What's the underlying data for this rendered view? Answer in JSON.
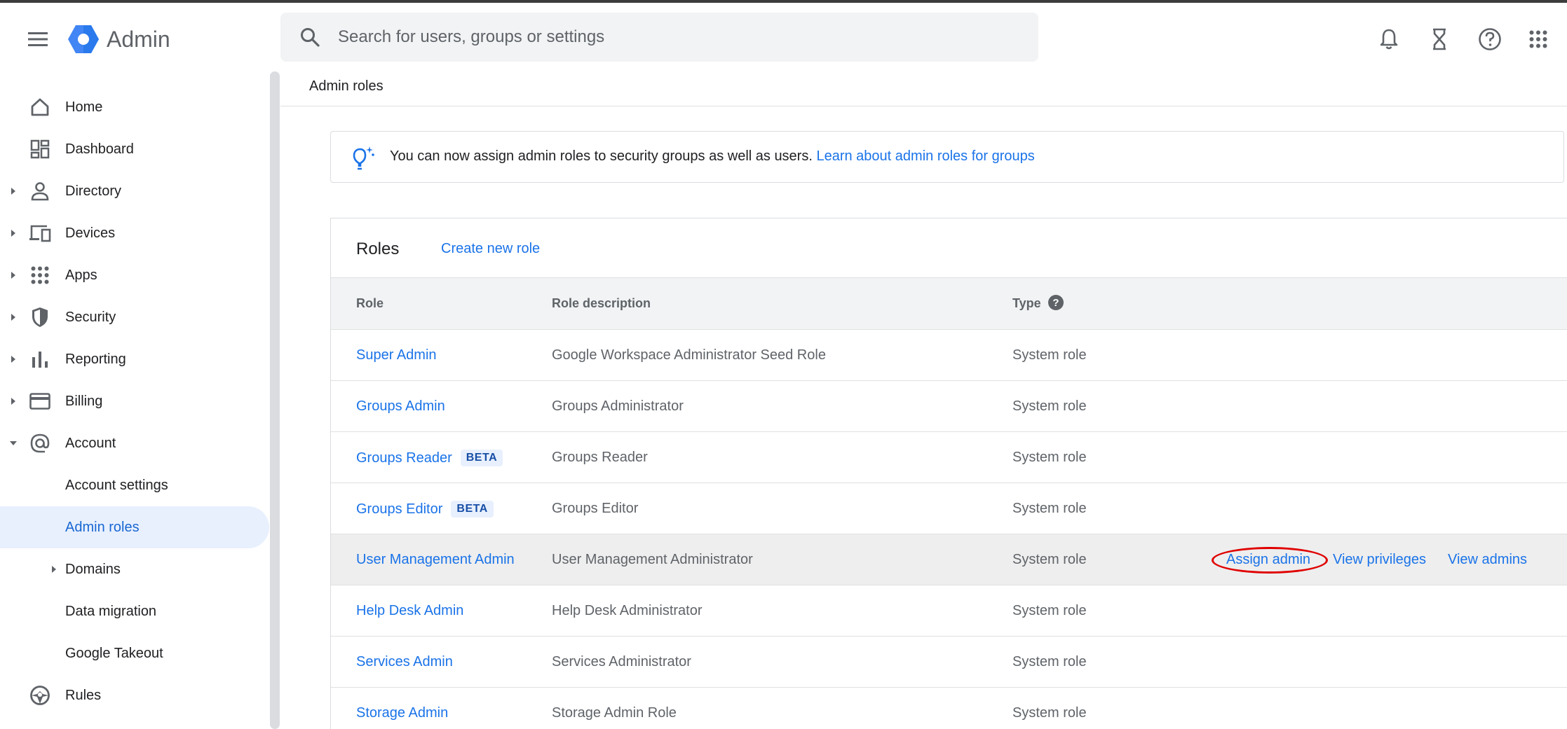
{
  "app": {
    "title": "Admin"
  },
  "search": {
    "placeholder": "Search for users, groups or settings"
  },
  "header_icons": [
    "notifications-icon",
    "tasks-hourglass-icon",
    "help-icon",
    "apps-grid-icon"
  ],
  "sidebar": {
    "items": [
      {
        "label": "Home",
        "icon": "home-icon",
        "expandable": false
      },
      {
        "label": "Dashboard",
        "icon": "dashboard-icon",
        "expandable": false
      },
      {
        "label": "Directory",
        "icon": "person-icon",
        "expandable": true
      },
      {
        "label": "Devices",
        "icon": "devices-icon",
        "expandable": true
      },
      {
        "label": "Apps",
        "icon": "apps-icon",
        "expandable": true
      },
      {
        "label": "Security",
        "icon": "shield-icon",
        "expandable": true
      },
      {
        "label": "Reporting",
        "icon": "bar-chart-icon",
        "expandable": true
      },
      {
        "label": "Billing",
        "icon": "credit-card-icon",
        "expandable": true
      },
      {
        "label": "Account",
        "icon": "at-sign-icon",
        "expandable": true,
        "expanded": true
      },
      {
        "label": "Account settings",
        "sub": true
      },
      {
        "label": "Admin roles",
        "sub": true,
        "active": true
      },
      {
        "label": "Domains",
        "sub": true,
        "expandable": true
      },
      {
        "label": "Data migration",
        "sub": true
      },
      {
        "label": "Google Takeout",
        "sub": true
      },
      {
        "label": "Rules",
        "icon": "rules-icon",
        "expandable": false
      }
    ]
  },
  "breadcrumb": "Admin roles",
  "banner": {
    "text": "You can now assign admin roles to security groups as well as users. ",
    "link": "Learn about admin roles for groups",
    "icon": "lightbulb-icon"
  },
  "roles": {
    "title": "Roles",
    "create_label": "Create new role",
    "columns": {
      "role": "Role",
      "description": "Role description",
      "type": "Type"
    },
    "rows": [
      {
        "role": "Super Admin",
        "beta": "",
        "description": "Google Workspace Administrator Seed Role",
        "type": "System role"
      },
      {
        "role": "Groups Admin",
        "beta": "",
        "description": "Groups Administrator",
        "type": "System role"
      },
      {
        "role": "Groups Reader",
        "beta": "BETA",
        "description": "Groups Reader",
        "type": "System role"
      },
      {
        "role": "Groups Editor",
        "beta": "BETA",
        "description": "Groups Editor",
        "type": "System role"
      },
      {
        "role": "User Management Admin",
        "beta": "",
        "description": "User Management Administrator",
        "type": "System role",
        "hovered": true
      },
      {
        "role": "Help Desk Admin",
        "beta": "",
        "description": "Help Desk Administrator",
        "type": "System role"
      },
      {
        "role": "Services Admin",
        "beta": "",
        "description": "Services Administrator",
        "type": "System role"
      },
      {
        "role": "Storage Admin",
        "beta": "",
        "description": "Storage Admin Role",
        "type": "System role"
      }
    ],
    "row_actions": {
      "assign": "Assign admin",
      "privileges": "View privileges",
      "admins": "View admins"
    }
  },
  "colors": {
    "accent": "#1a73e8",
    "active_bg": "#e8f0fe",
    "highlight_ring": "#e00000"
  }
}
